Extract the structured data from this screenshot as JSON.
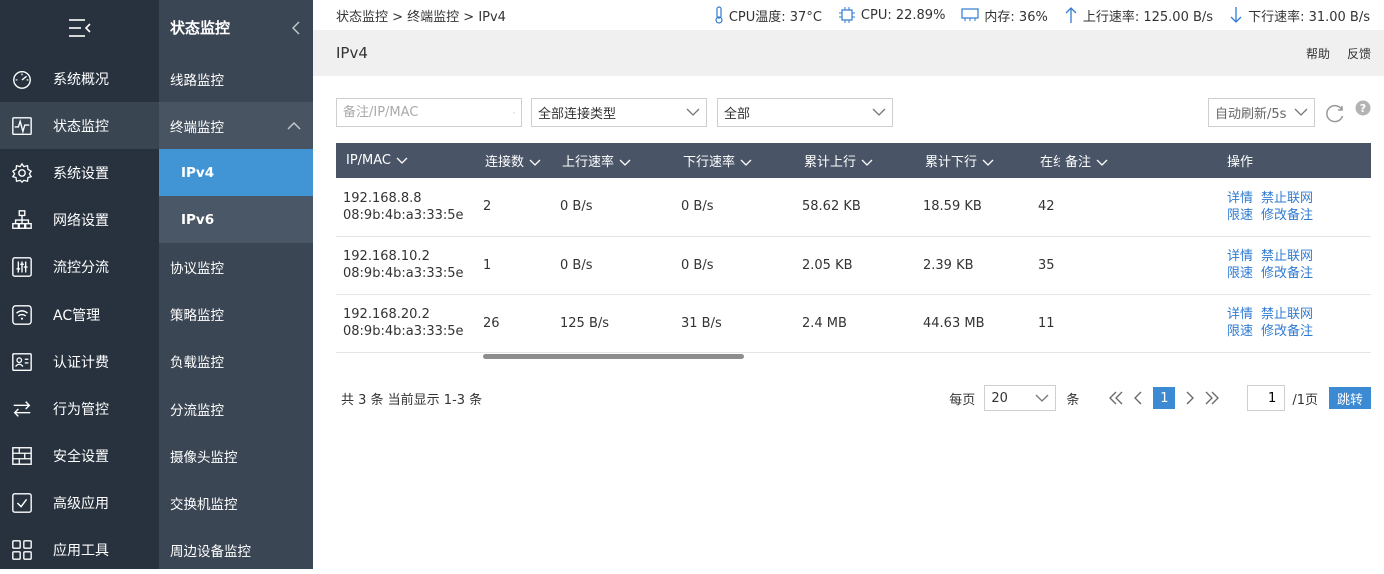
{
  "nav": {
    "items": [
      {
        "label": "系统概况",
        "icon": "dashboard-icon"
      },
      {
        "label": "状态监控",
        "icon": "pulse-icon"
      },
      {
        "label": "系统设置",
        "icon": "gear-icon"
      },
      {
        "label": "网络设置",
        "icon": "network-icon"
      },
      {
        "label": "流控分流",
        "icon": "sliders-icon"
      },
      {
        "label": "AC管理",
        "icon": "wifi-icon"
      },
      {
        "label": "认证计费",
        "icon": "id-card-icon"
      },
      {
        "label": "行为管控",
        "icon": "arrows-icon"
      },
      {
        "label": "安全设置",
        "icon": "firewall-icon"
      },
      {
        "label": "高级应用",
        "icon": "check-box-icon"
      },
      {
        "label": "应用工具",
        "icon": "apps-icon"
      }
    ]
  },
  "subnav": {
    "title": "状态监控",
    "items": [
      {
        "label": "线路监控"
      },
      {
        "label": "终端监控"
      },
      {
        "label": "IPv4"
      },
      {
        "label": "IPv6"
      },
      {
        "label": "协议监控"
      },
      {
        "label": "策略监控"
      },
      {
        "label": "负载监控"
      },
      {
        "label": "分流监控"
      },
      {
        "label": "摄像头监控"
      },
      {
        "label": "交换机监控"
      },
      {
        "label": "周边设备监控"
      }
    ]
  },
  "status": {
    "breadcrumb": "状态监控 > 终端监控 > IPv4",
    "cpu_temp": "CPU温度: 37°C",
    "cpu": "CPU: 22.89%",
    "mem": "内存: 36%",
    "up_rate": "上行速率: 125.00 B/s",
    "down_rate": "下行速率: 31.00 B/s"
  },
  "page": {
    "title": "IPv4",
    "help": "帮助",
    "feedback": "反馈"
  },
  "toolbar": {
    "search_placeholder": "备注/IP/MAC",
    "conn_type": "全部连接类型",
    "scope": "全部",
    "auto_refresh": "自动刷新/5s"
  },
  "table": {
    "headers": [
      "IP/MAC",
      "连接数",
      "上行速率",
      "下行速率",
      "累计上行",
      "累计下行",
      "在线",
      "备注",
      "操作"
    ],
    "rows": [
      {
        "ip": "192.168.8.8",
        "mac": "08:9b:4b:a3:33:5e",
        "conns": "2",
        "up": "0 B/s",
        "down": "0 B/s",
        "total_up": "58.62 KB",
        "total_down": "18.59 KB",
        "online": "42"
      },
      {
        "ip": "192.168.10.2",
        "mac": "08:9b:4b:a3:33:5e",
        "conns": "1",
        "up": "0 B/s",
        "down": "0 B/s",
        "total_up": "2.05 KB",
        "total_down": "2.39 KB",
        "online": "35"
      },
      {
        "ip": "192.168.20.2",
        "mac": "08:9b:4b:a3:33:5e",
        "conns": "26",
        "up": "125 B/s",
        "down": "31 B/s",
        "total_up": "2.4 MB",
        "total_down": "44.63 MB",
        "online": "11"
      }
    ],
    "ops": {
      "detail": "详情",
      "block": "禁止联网",
      "limit": "限速",
      "edit_note": "修改备注"
    }
  },
  "footer": {
    "total": "共 3 条 当前显示 1-3 条",
    "per_page_label": "每页",
    "per_page": "20",
    "per_page_unit": "条",
    "current_page": "1",
    "goto_value": "1",
    "pages_suffix": "/1页",
    "jump": "跳转"
  }
}
